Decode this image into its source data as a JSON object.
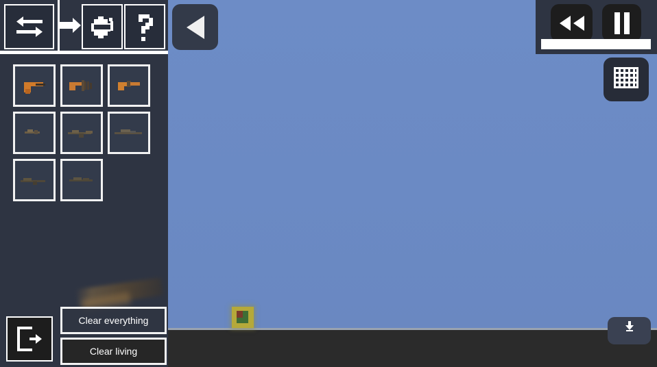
{
  "app": {
    "title": "Sandbox Weapon Editor",
    "background_color": "#6b8ac4",
    "sidebar_color": "#2e3442",
    "ground_color": "#2b2b2b"
  },
  "sidebar": {
    "toolbar": {
      "buttons": [
        {
          "name": "swap-arrows-icon",
          "label": "Swap",
          "icon": "swap-arrows-icon"
        },
        {
          "name": "arrow-right-icon",
          "label": "Next",
          "icon": "arrow-right-icon"
        },
        {
          "name": "paint-bucket-icon",
          "label": "Paint",
          "icon": "paint-bucket-icon"
        },
        {
          "name": "question-mark-icon",
          "label": "?",
          "icon": "question-mark-icon"
        }
      ]
    },
    "inventory": {
      "slots": [
        {
          "label": "Pistol",
          "color": "#d07a2a",
          "variant": "pistol"
        },
        {
          "label": "Submachine Gun",
          "color": "#c97a32",
          "variant": "smg"
        },
        {
          "label": "Revolver",
          "color": "#d0802f",
          "variant": "revolver"
        },
        {
          "label": "Rifle",
          "color": "#6b5c44",
          "variant": "rifle"
        },
        {
          "label": "Assault Rifle",
          "color": "#5d5340",
          "variant": "assault"
        },
        {
          "label": "Sniper Rifle",
          "color": "#5a5142",
          "variant": "sniper"
        },
        {
          "label": "Shotgun",
          "color": "#4f4staging",
          "variant": "shotgun"
        },
        {
          "label": "Carbine",
          "color": "#4d4738",
          "variant": "carbine"
        }
      ]
    },
    "exit_button": {
      "label": "Exit",
      "icon": "exit-door-icon"
    },
    "clear_buttons": [
      {
        "label": "Clear everything"
      },
      {
        "label": "Clear living"
      }
    ]
  },
  "navigation": {
    "back_button": {
      "label": "Back",
      "icon": "play-left-icon"
    }
  },
  "playback": {
    "rewind_button": {
      "label": "Rewind",
      "icon": "rewind-icon"
    },
    "pause_button": {
      "label": "Pause",
      "icon": "pause-icon"
    },
    "progress": {
      "value": 100,
      "unit": "%"
    },
    "grid_button": {
      "label": "Grid",
      "icon": "grid-icon"
    }
  },
  "bottom_right": {
    "button": {
      "label": "Download",
      "icon": "download-icon"
    }
  },
  "world": {
    "object": {
      "label": "Crate",
      "color": "#b5a93a"
    }
  }
}
